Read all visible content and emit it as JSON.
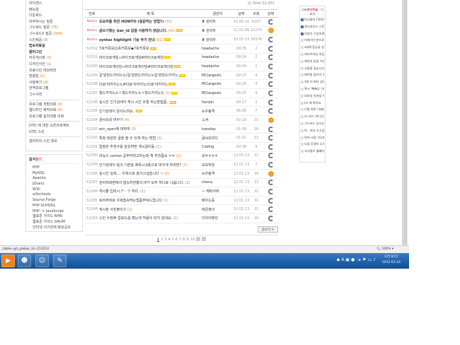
{
  "sidebar": {
    "menu": [
      {
        "label": "라이센스"
      },
      {
        "label": "매뉴얼"
      },
      {
        "label": "다운로드"
      },
      {
        "label": "자주하시는 질문"
      },
      {
        "label": "그누보드 질문",
        "count": "(76)"
      },
      {
        "label": "그누보드5 질문",
        "count": "(306)"
      },
      {
        "label": "스킨제공",
        "count": "(8)"
      },
      {
        "label": "팁&자료실",
        "bold": true
      },
      {
        "label": "플러그인",
        "bold": true
      },
      {
        "label": "자유게시판",
        "count": "(3)"
      },
      {
        "label": "디자인사진",
        "count": "(1)"
      },
      {
        "label": "유료스킨 데모버전"
      },
      {
        "label": "방울팁",
        "count": "(2)"
      },
      {
        "label": "사용후기",
        "count": "(4)"
      },
      {
        "label": "번역프로그램"
      },
      {
        "label": "그누사전"
      }
    ],
    "menu2": [
      {
        "label": "프로그램 개발의뢰",
        "count": "(9)"
      },
      {
        "label": "웹디자인 제작의뢰",
        "count": "(6)"
      },
      {
        "label": "프로그램 설치대행 의뢰"
      }
    ],
    "menu3": [
      {
        "label": "DTD 에 대한 오픈프로젝트"
      },
      {
        "label": "DTD 스킨"
      }
    ],
    "menu4": [
      {
        "label": "갤러리의 스킨 데모"
      }
    ],
    "links_title": "즐겨",
    "links_title_accent": "찾기",
    "links": [
      "PHP",
      "MySQL",
      "Apache",
      "jQuery",
      "W3C",
      "w3schools",
      "Source Forge",
      "PHP SCHOOL",
      "PHP -> JavaScript",
      "웹표준 가이드 NHN",
      "웹표준 가이드 DAUM",
      "인터넷 서기관에 정보공유"
    ]
  },
  "board": {
    "total": "Total 52,302",
    "headers": [
      "번호",
      "제 목",
      "글쓴이",
      "날짜",
      "조회",
      "상태"
    ],
    "rows": [
      {
        "num": "Notice",
        "title": "초보자를 위한 HOWTO (질문하는 방법?)",
        "cmt": "(31)",
        "author": "관리자",
        "date": "11.06.16",
        "views": "6207",
        "hot": false,
        "notice": true
      },
      {
        "num": "Notice",
        "title": "글쓰기에는 $wr_id 값을 사용하지 않습니다.",
        "cmt": "(41)",
        "author": "관리자",
        "date": "11.02.06",
        "views": "21274",
        "hot": true,
        "notice": true,
        "new": true
      },
      {
        "num": "Notice",
        "title": "syntax highlight 기능 추가 안내",
        "cmt": "(31)",
        "author": "관리자",
        "date": "10.03.23",
        "views": "26378",
        "hot": false,
        "notice": true,
        "new": true
      },
      {
        "num": "52302",
        "title": "7포커족보[1포커족보◆7포커족보",
        "cmt": "",
        "author": "headache",
        "date": "09:35",
        "views": "2",
        "hot": false,
        "new": true
      },
      {
        "num": "52301",
        "title": "마이크로게임≈마이크로게임#마이크로게임",
        "cmt": "",
        "author": "headache",
        "date": "09:34",
        "views": "2",
        "hot": false,
        "new": true
      },
      {
        "num": "52300",
        "title": "마이크로게이밍≈마이크로게이밍#마이크로게이밍",
        "cmt": "",
        "author": "headache",
        "date": "09:34",
        "views": "2",
        "hot": false,
        "new": true
      },
      {
        "num": "52299",
        "title": "갈'원펀드카지노노/갈'원펀드카지노누갈'원펀드카지노",
        "cmt": "",
        "author": "MClargests",
        "date": "09:27",
        "views": "4",
        "hot": false,
        "new": true
      },
      {
        "num": "52298",
        "title": "더로'야카지노노#더로'야카지노/더로'야카지노",
        "cmt": "",
        "author": "MClargests",
        "date": "09:26",
        "views": "4",
        "hot": false,
        "new": true
      },
      {
        "num": "52297",
        "title": "월드카지노노ㅏ월드카지노노ㅜ월드카지노노",
        "cmt": "(1)",
        "author": "MClargests",
        "date": "09:25",
        "views": "4",
        "hot": false,
        "new": true
      },
      {
        "num": "52296",
        "title": "실시간 인기검색어 캐시 시간 조절 하는방법좀..",
        "cmt": "",
        "author": "herojin",
        "date": "09:17",
        "views": "3",
        "hot": false,
        "new": true
      },
      {
        "num": "52295",
        "title": "인기검색어 문의드려요..",
        "cmt": "",
        "author": "뉴우탐격",
        "date": "06:08",
        "views": "7",
        "hot": false,
        "new": true
      },
      {
        "num": "52294",
        "title": "글씨속성 바꾸기",
        "cmt": "(4)",
        "author": "三木",
        "date": "02:19",
        "views": "21",
        "hot": true
      },
      {
        "num": "52293",
        "title": "win_open에 대하여",
        "cmt": "(3)",
        "author": "tuesday",
        "date": "01:08",
        "views": "16",
        "hot": false
      },
      {
        "num": "52292",
        "title": "특정 회원만 글을 쓸 수 있게 하는 방법",
        "cmt": "(3)",
        "author": "글씨모리다",
        "date": "01:01",
        "views": "13",
        "hot": false
      },
      {
        "num": "52291",
        "title": "일정한 추천수를 달성하면 게시글이동",
        "cmt": "(1)",
        "author": "Coding",
        "date": "00:38",
        "views": "9",
        "hot": false
      },
      {
        "num": "52290",
        "title": "리눅스 centos 공부하려고하는데 책 추천좀요 ㅠㅠ",
        "cmt": "(2)",
        "author": "모수ㅎㅎㅎ",
        "date": "12.01.13",
        "views": "11",
        "hot": false
      },
      {
        "num": "52289",
        "title": "인기검색어 링크 기본을 제목+내용으로 바꾸게 하려면?",
        "cmt": "(1)",
        "author": "모모하임",
        "date": "12.01.13",
        "views": "7",
        "hot": false
      },
      {
        "num": "52288",
        "title": "실시간 검색.... 우측으로 옮기고싶습니다 ~",
        "cmt": "(2)",
        "author": "뉴우탐격",
        "date": "12.01.13",
        "views": "19",
        "hot": true
      },
      {
        "num": "52287",
        "title": "관리자화면에서 접속자현황의 IP가 모두 하나로 나옵니다.",
        "cmt": "(2)",
        "author": "chena",
        "date": "12.01.13",
        "views": "13",
        "hot": false
      },
      {
        "num": "52286",
        "title": "게시물 입력시 /* - */ 처리.",
        "cmt": "(1)",
        "author": "케파서버",
        "date": "12.01.13",
        "views": "22",
        "hot": false,
        "star": true
      },
      {
        "num": "52285",
        "title": "토비주비로 우회접속막는법좀부탁드립니다",
        "cmt": "(1)",
        "author": "배우는중",
        "date": "12.01.13",
        "views": "31",
        "hot": false
      },
      {
        "num": "52284",
        "title": "게시판 사진붙이기",
        "cmt": "(1)",
        "author": "레몬파이",
        "date": "12.01.13",
        "views": "21",
        "hot": false
      },
      {
        "num": "52283",
        "title": "스킨 수정후 업로드를 했는데 적용이 되지 않네요.",
        "cmt": "(2)",
        "author": "다이어레킷",
        "date": "12.01.13",
        "views": "16",
        "hot": false
      }
    ],
    "write_label": "글쓰기",
    "pages": [
      "1",
      "2",
      "3",
      "4",
      "5",
      "6",
      "7",
      "8",
      "9",
      "10"
    ]
  },
  "recent": {
    "title_pre": "오늘",
    "title_accent": "최다댓글",
    "more": "· 더보기",
    "items": [
      "박시털러 CSS3 into..",
      "관리자모드 스킨입..",
      "모빌진 구입하겠다..",
      "어제 아는분으로 부..",
      "sql에 중급글 있어..",
      "데러브러닝 여깁니..",
      "해적자 분들 이용 ..",
      "사람을 찾습니다.",
      "해적원 들어가 정년..",
      "3위 의 최다 검색 ..",
      "혹시 '빽빠다' 하는 ..",
      "모바일 인포맞 해스..",
      "LA 에 취어요.",
      "이럴 착한 이제인도..",
      "cn 보드 허디건지 ..",
      "그누보드 입사신청..",
      "아.. 회사 가고싶다..",
      "면허 사람 치고왔습..",
      "다음 투쟁의 도메인..",
      "사고팔로 홀빼이저 .."
    ]
  },
  "status": {
    "url": "_table=g4_qa&wr_id=213252",
    "zoom": "100%"
  },
  "taskbar": {
    "time": "오전 8:57",
    "date": "2012-01-14"
  }
}
